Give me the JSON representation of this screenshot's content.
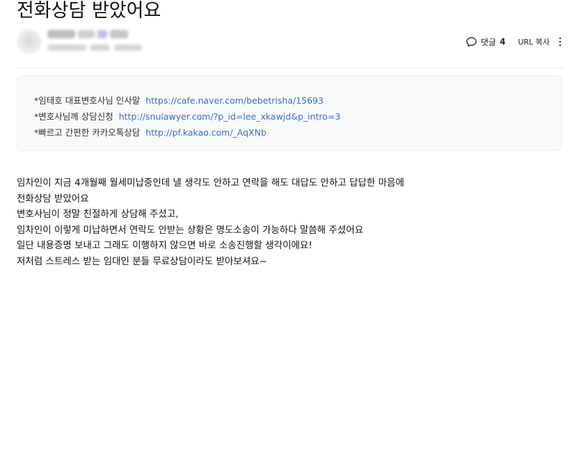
{
  "post": {
    "title": "전화상담 받았어요",
    "actions": {
      "comment_label": "댓글",
      "comment_count": "4",
      "url_copy_label": "URL 복사"
    }
  },
  "info_box": {
    "lines": [
      {
        "label": "*임태호 대표변호사님 인사말",
        "link": "https://cafe.naver.com/bebetrisha/15693"
      },
      {
        "label": "*변호사님께 상담신청",
        "link": "http://snulawyer.com/?p_id=lee_xkawjd&p_intro=3"
      },
      {
        "label": "*빠르고 간편한 카카오톡상담",
        "link": "http://pf.kakao.com/_AqXNb"
      }
    ]
  },
  "content": {
    "lines": [
      "임차인이 지금 4개월째 월세미납중인데 낼 생각도 안하고 연락을 해도 대답도 안하고 답답한 마음에",
      "전화상담 받았어요",
      "변호사님이 정말 친절하게 상담해 주셨고,",
      "임차인이 이렇게 미납하면서 연락도 안받는 상황은 명도소송이 가능하다 말씀해 주셨어요",
      "일단 내용증명 보내고 그래도 이행하지 않으면 바로 소송진행할 생각이에요!",
      "저처럼 스트레스 받는 임대인 분들 무료상담이라도 받아보셔요~"
    ]
  },
  "icons": {
    "comment": "speech-bubble-icon",
    "more": "vertical-ellipsis-icon"
  },
  "colors": {
    "link": "#3b6fb6",
    "box_background": "#f8f9fb"
  }
}
